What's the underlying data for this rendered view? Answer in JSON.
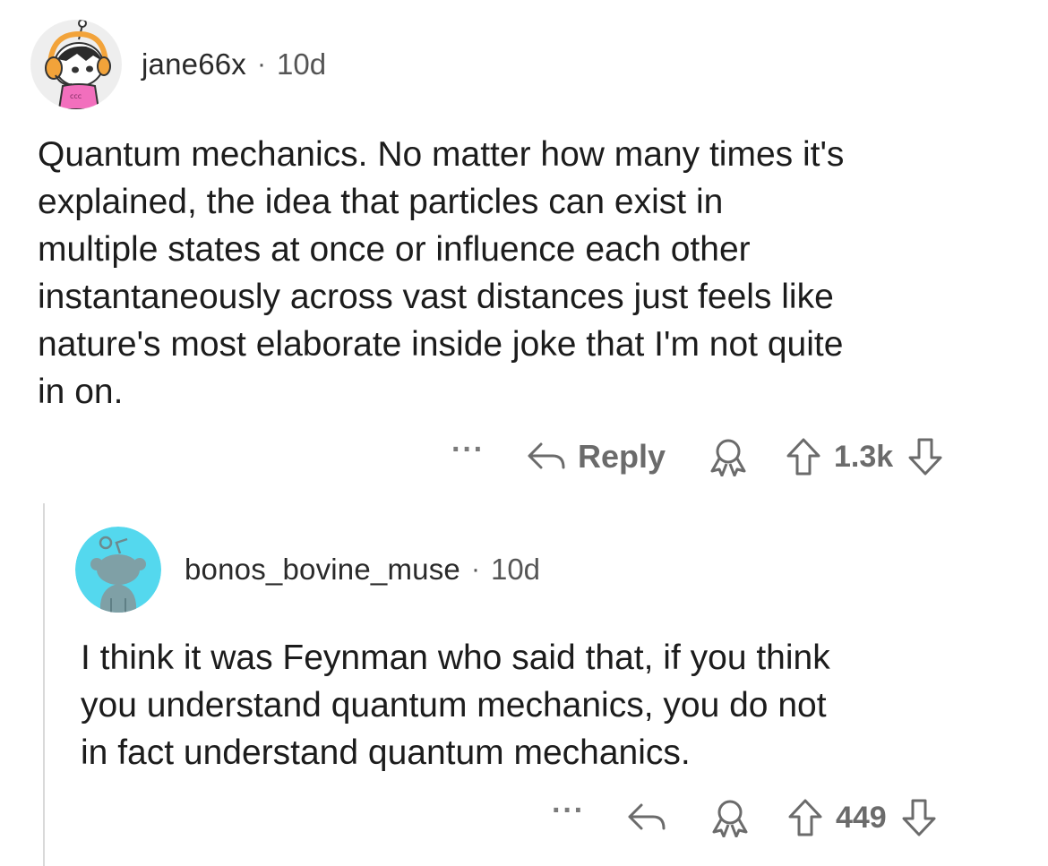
{
  "comments": [
    {
      "username": "jane66x",
      "separator": "·",
      "age": "10d",
      "body": "Quantum mechanics. No matter how many times it's\nexplained, the idea that particles can exist in\nmultiple states at once or influence each other\ninstantaneously across vast distances just feels like\nnature's most elaborate inside joke that I'm not quite\nin on.",
      "more_label": "···",
      "reply_label": "Reply",
      "score": "1.3k",
      "avatar_icon": "snoo-avatar-headphones-icon"
    },
    {
      "username": "bonos_bovine_muse",
      "separator": "·",
      "age": "10d",
      "body": "I think it was Feynman who said that, if you think\nyou understand quantum mechanics, you do not\nin fact understand quantum mechanics.",
      "more_label": "···",
      "score": "449",
      "avatar_icon": "snoo-default-avatar-icon"
    }
  ],
  "colors": {
    "text": "#1c1c1c",
    "meta": "#555555",
    "action": "#6b6b6b",
    "thread_line": "#d9d9d9",
    "avatar2_bg": "#54d8ee"
  }
}
